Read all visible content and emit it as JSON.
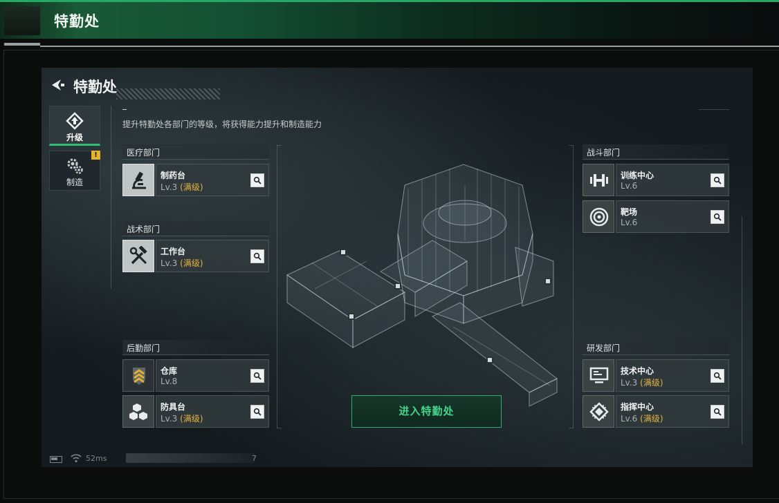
{
  "header": {
    "title": "特勤处"
  },
  "screen": {
    "title": "特勤处",
    "intro": "提升特勤处各部门的等级，将获得能力提升和制造能力",
    "tabs": [
      {
        "label": "升级",
        "active": true,
        "icon": "upgrade-icon"
      },
      {
        "label": "制造",
        "active": false,
        "icon": "gears-icon",
        "badge": "!"
      }
    ],
    "departments": {
      "medical": {
        "label": "医疗部门",
        "facilities": [
          {
            "name": "制药台",
            "level": "Lv.3",
            "max": "(满级)",
            "icon": "microscope-icon"
          }
        ]
      },
      "tactical": {
        "label": "战术部门",
        "facilities": [
          {
            "name": "工作台",
            "level": "Lv.3",
            "max": "(满级)",
            "icon": "tools-icon"
          }
        ]
      },
      "logistics": {
        "label": "后勤部门",
        "facilities": [
          {
            "name": "仓库",
            "level": "Lv.8",
            "max": "",
            "icon": "chevrons-icon"
          },
          {
            "name": "防具台",
            "level": "Lv.3",
            "max": "(满级)",
            "icon": "cubes-icon"
          }
        ]
      },
      "combat": {
        "label": "战斗部门",
        "facilities": [
          {
            "name": "训练中心",
            "level": "Lv.6",
            "max": "",
            "icon": "dumbbell-icon"
          },
          {
            "name": "靶场",
            "level": "Lv.6",
            "max": "",
            "icon": "target-icon"
          }
        ]
      },
      "research": {
        "label": "研发部门",
        "facilities": [
          {
            "name": "技术中心",
            "level": "Lv.3",
            "max": "(满级)",
            "icon": "monitor-icon"
          },
          {
            "name": "指挥中心",
            "level": "Lv.6",
            "max": "(满级)",
            "icon": "chip-icon"
          }
        ]
      }
    },
    "enter_button": "进入特勤处",
    "status": {
      "ping": "52ms",
      "uid_tail": "7"
    }
  },
  "colors": {
    "accent_green": "#2fbf74",
    "maxed_gold": "#e4b341",
    "badge_yellow": "#e5b230"
  }
}
